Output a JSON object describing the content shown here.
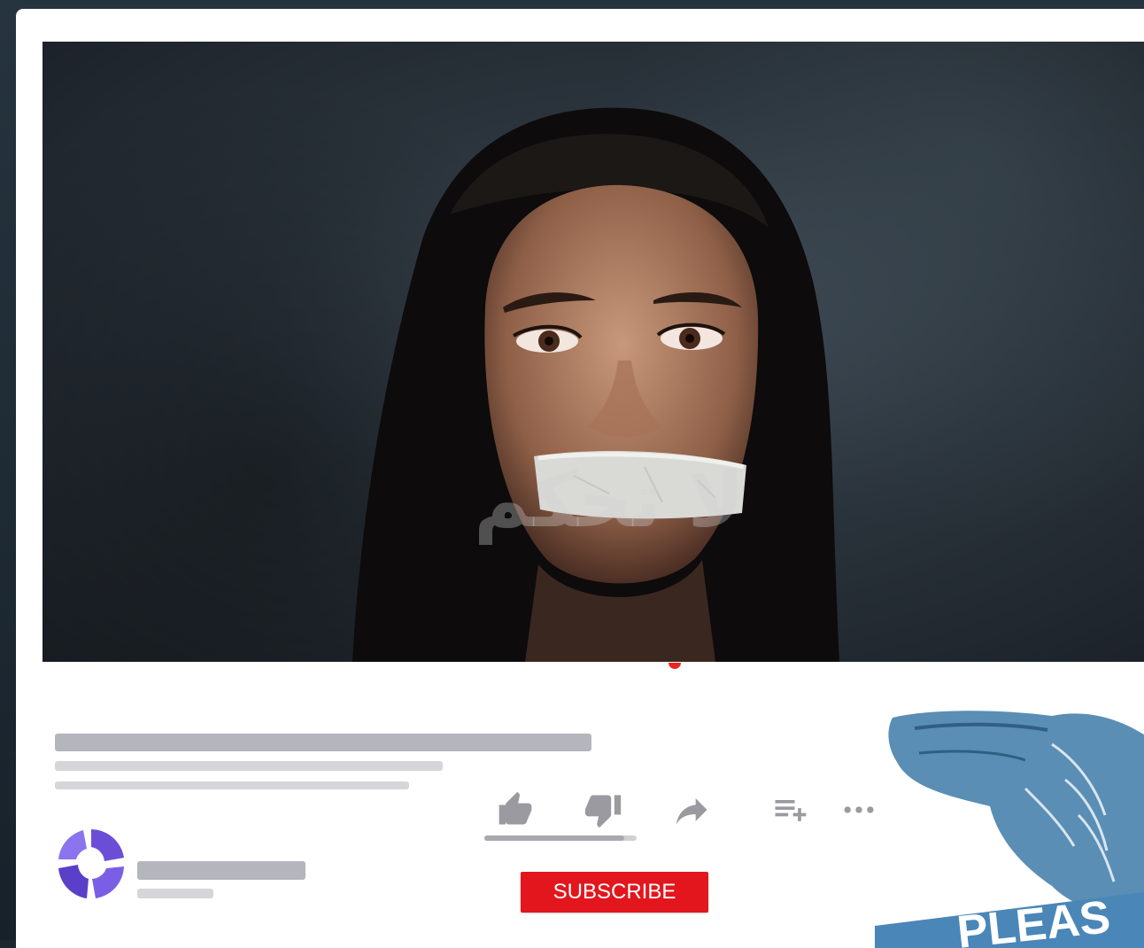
{
  "video": {
    "overlay_text": "لا تحكم",
    "progress_color": "#ee2222"
  },
  "actions": [
    {
      "name": "like",
      "icon": "thumb-up-icon"
    },
    {
      "name": "dislike",
      "icon": "thumb-down-icon"
    },
    {
      "name": "share",
      "icon": "share-arrow-icon"
    },
    {
      "name": "add-to-playlist",
      "icon": "playlist-add-icon"
    },
    {
      "name": "more",
      "icon": "more-horizontal-icon"
    }
  ],
  "sentiment": {
    "like_ratio": 0.92
  },
  "subscribe": {
    "label": "SUBSCRIBE",
    "color": "#e2161c"
  },
  "pointer_art": {
    "text": "PLEAS",
    "color": "#5b8eb5"
  },
  "channel": {
    "logo_color": "#6b4ed8"
  }
}
